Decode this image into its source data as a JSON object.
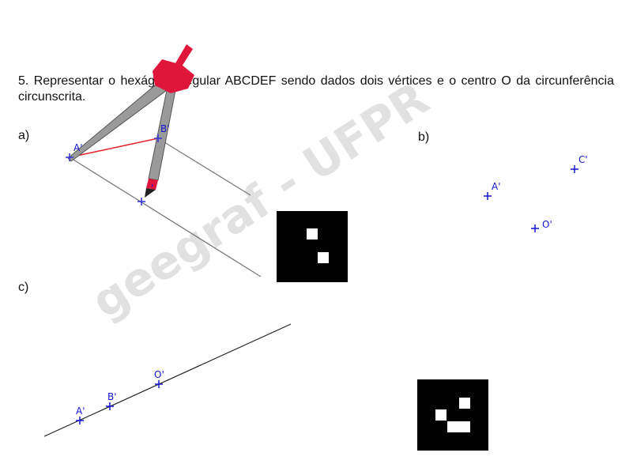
{
  "task": {
    "text": "5. Representar o hexágono regular ABCDEF sendo dados dois vértices e o centro O da circunferência circunscrita."
  },
  "parts": {
    "a": "a)",
    "b": "b)",
    "c": "c)"
  },
  "points": {
    "a_A": "A'",
    "a_B": "B'",
    "a_C": "'",
    "b_A": "A'",
    "b_C": "C'",
    "b_O": "O'",
    "c_A": "A'",
    "c_B": "B'",
    "c_O": "O'"
  },
  "watermark": "geegraf - UFPR",
  "colors": {
    "point_blue": "#1414d2",
    "construction_red": "#e8282e",
    "compass_red": "#e0153c",
    "compass_grey": "#9a9a9a",
    "line_grey": "#7a7a7a",
    "qr_black": "#000000"
  },
  "icons": [
    "compass-icon",
    "qr-code-icon"
  ]
}
